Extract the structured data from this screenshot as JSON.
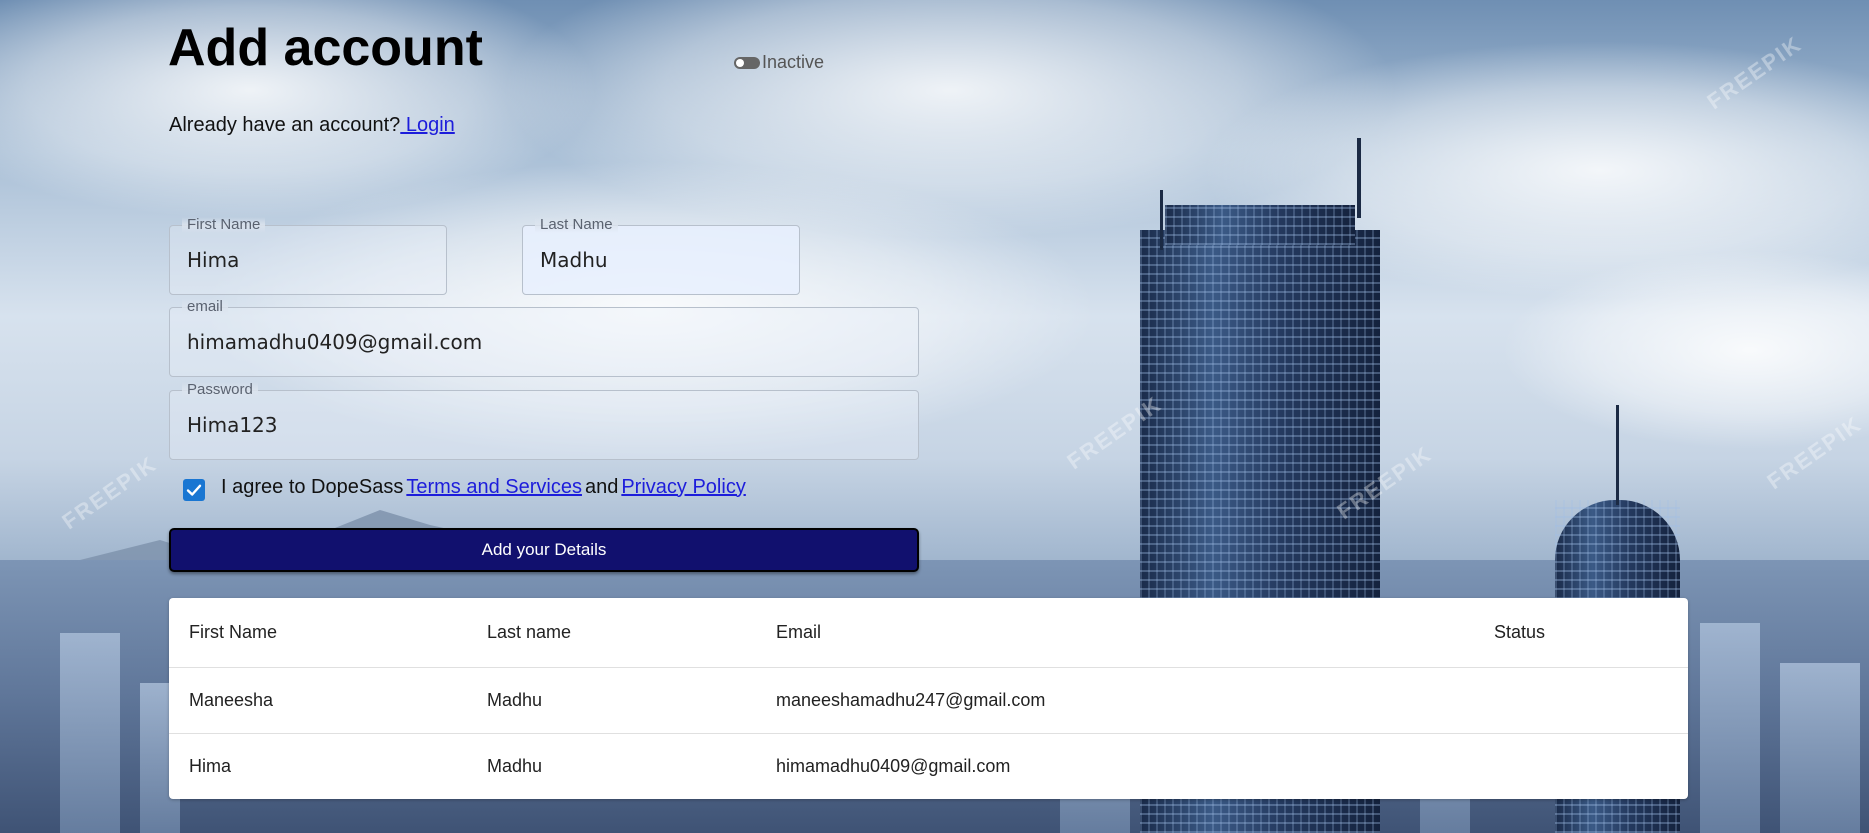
{
  "page": {
    "title": "Add account",
    "status_toggle_label": "Inactive",
    "login_prompt": "Already have an account?",
    "login_link": " Login"
  },
  "form": {
    "first_name": {
      "label": "First Name",
      "value": "Hima"
    },
    "last_name": {
      "label": "Last Name",
      "value": "Madhu"
    },
    "email": {
      "label": "email",
      "value": "himamadhu0409@gmail.com"
    },
    "password": {
      "label": "Password",
      "value": "Hima123"
    },
    "agree": {
      "checked": true,
      "text_before": "I agree to DopeSass",
      "terms_link": " Terms and Services ",
      "middle": "and",
      "privacy_link": " Privacy Policy "
    },
    "submit_label": "Add your Details"
  },
  "table": {
    "headers": [
      "First Name",
      "Last name",
      "Email",
      "Status"
    ],
    "rows": [
      [
        "Maneesha",
        "Madhu",
        "maneeshamadhu247@gmail.com",
        ""
      ],
      [
        "Hima",
        "Madhu",
        "himamadhu0409@gmail.com",
        ""
      ]
    ]
  },
  "background": {
    "watermark": "FREEPIK"
  },
  "colors": {
    "submit_bg": "#11106e",
    "checkbox": "#1976d2",
    "link": "#1d1ddb"
  }
}
